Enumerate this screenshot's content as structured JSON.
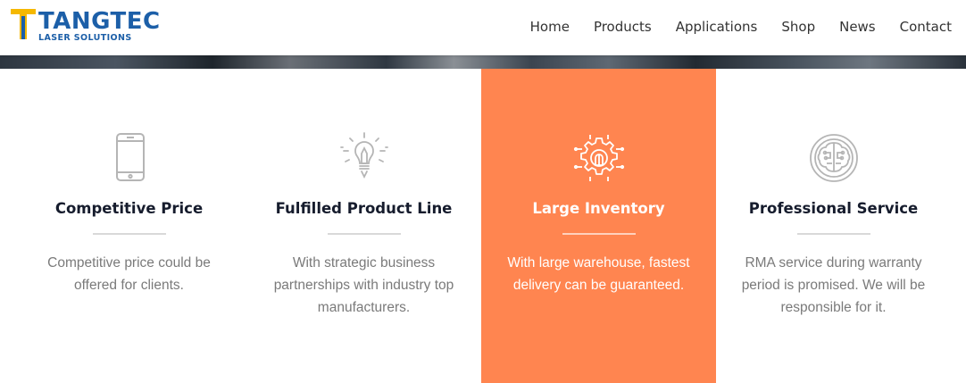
{
  "brand": {
    "name": "TANGTEC",
    "tagline": "LASER SOLUTIONS",
    "colors": {
      "primary": "#1c5fa8",
      "accent": "#f5b800"
    }
  },
  "nav": {
    "items": [
      {
        "label": "Home"
      },
      {
        "label": "Products"
      },
      {
        "label": "Applications"
      },
      {
        "label": "Shop"
      },
      {
        "label": "News"
      },
      {
        "label": "Contact"
      }
    ]
  },
  "features": [
    {
      "icon": "mobile-phone-icon",
      "title": "Competitive Price",
      "lines": [
        "Competitive price could be",
        "offered for clients."
      ]
    },
    {
      "icon": "lightbulb-pencil-icon",
      "title": "Fulfilled Product Line",
      "lines": [
        "With strategic business",
        "partnerships with industry top",
        "manufacturers."
      ]
    },
    {
      "icon": "gear-circuit-icon",
      "title": "Large Inventory",
      "lines": [
        "With large warehouse, fastest",
        "delivery can be guaranteed."
      ],
      "highlight_color": "#ff8550"
    },
    {
      "icon": "brain-circuit-icon",
      "title": "Professional Service",
      "lines": [
        "RMA service during warranty",
        "period is promised. We will be",
        "responsible for it."
      ]
    }
  ]
}
